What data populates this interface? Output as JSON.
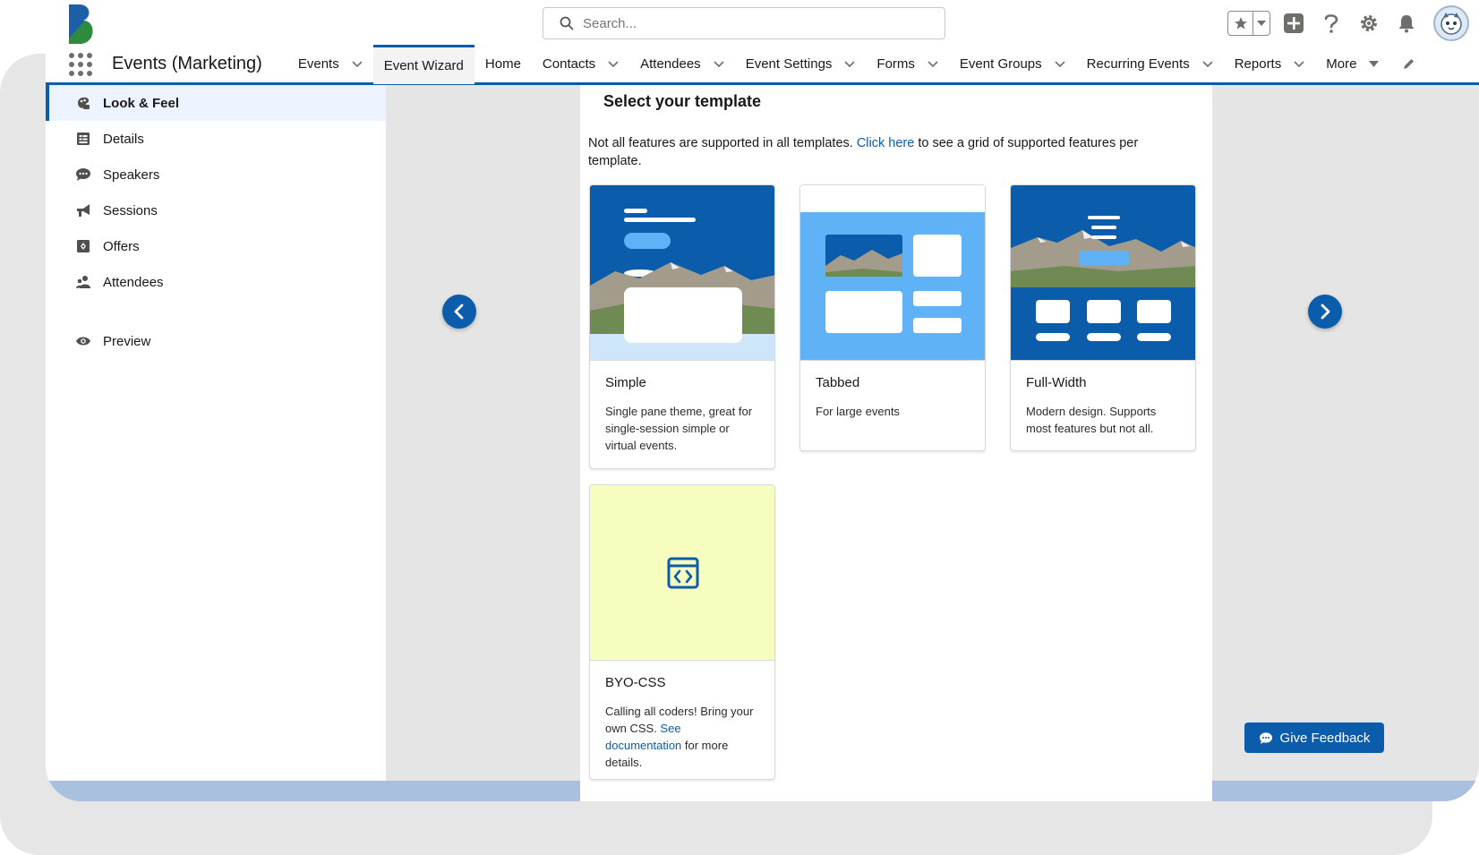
{
  "header": {
    "search_placeholder": "Search...",
    "icons": [
      "star-icon",
      "add-icon",
      "help-icon",
      "gear-icon",
      "bell-icon",
      "avatar"
    ]
  },
  "nav": {
    "app_name": "Events (Marketing)",
    "items": [
      {
        "label": "Events",
        "dropdown": true
      },
      {
        "label": "Event Wizard",
        "dropdown": false,
        "active": true
      },
      {
        "label": "Home",
        "dropdown": false
      },
      {
        "label": "Contacts",
        "dropdown": true
      },
      {
        "label": "Attendees",
        "dropdown": true
      },
      {
        "label": "Event Settings",
        "dropdown": true
      },
      {
        "label": "Forms",
        "dropdown": true
      },
      {
        "label": "Event Groups",
        "dropdown": true
      },
      {
        "label": "Recurring Events",
        "dropdown": true
      },
      {
        "label": "Reports",
        "dropdown": true
      },
      {
        "label": "More",
        "dropdown": true
      }
    ]
  },
  "sidebar": {
    "items": [
      {
        "label": "Look & Feel",
        "icon": "palette-icon",
        "active": true
      },
      {
        "label": "Details",
        "icon": "details-icon"
      },
      {
        "label": "Speakers",
        "icon": "chat-icon"
      },
      {
        "label": "Sessions",
        "icon": "megaphone-icon"
      },
      {
        "label": "Offers",
        "icon": "offer-icon"
      },
      {
        "label": "Attendees",
        "icon": "people-icon"
      }
    ],
    "preview_label": "Preview"
  },
  "main": {
    "title": "Select your template",
    "desc_before": "Not all features are supported in all templates. ",
    "desc_link": "Click here",
    "desc_after": " to see a grid of supported features per template.",
    "templates": [
      {
        "name": "Simple",
        "desc": "Single pane theme, great for single-session simple or virtual events."
      },
      {
        "name": "Tabbed",
        "desc": "For large events"
      },
      {
        "name": "Full-Width",
        "desc": "Modern design. Supports most features but not all."
      },
      {
        "name": "BYO-CSS",
        "desc_before": "Calling all coders! Bring your own CSS. ",
        "desc_link": "See documentation",
        "desc_after": " for more details."
      }
    ]
  },
  "feedback": {
    "label": "Give Feedback"
  },
  "colors": {
    "brand": "#0b5cab",
    "nav_underline": "#0b5cab",
    "byo_bg": "#f7fcbf",
    "tabbed_bg": "#5fb2f5"
  }
}
